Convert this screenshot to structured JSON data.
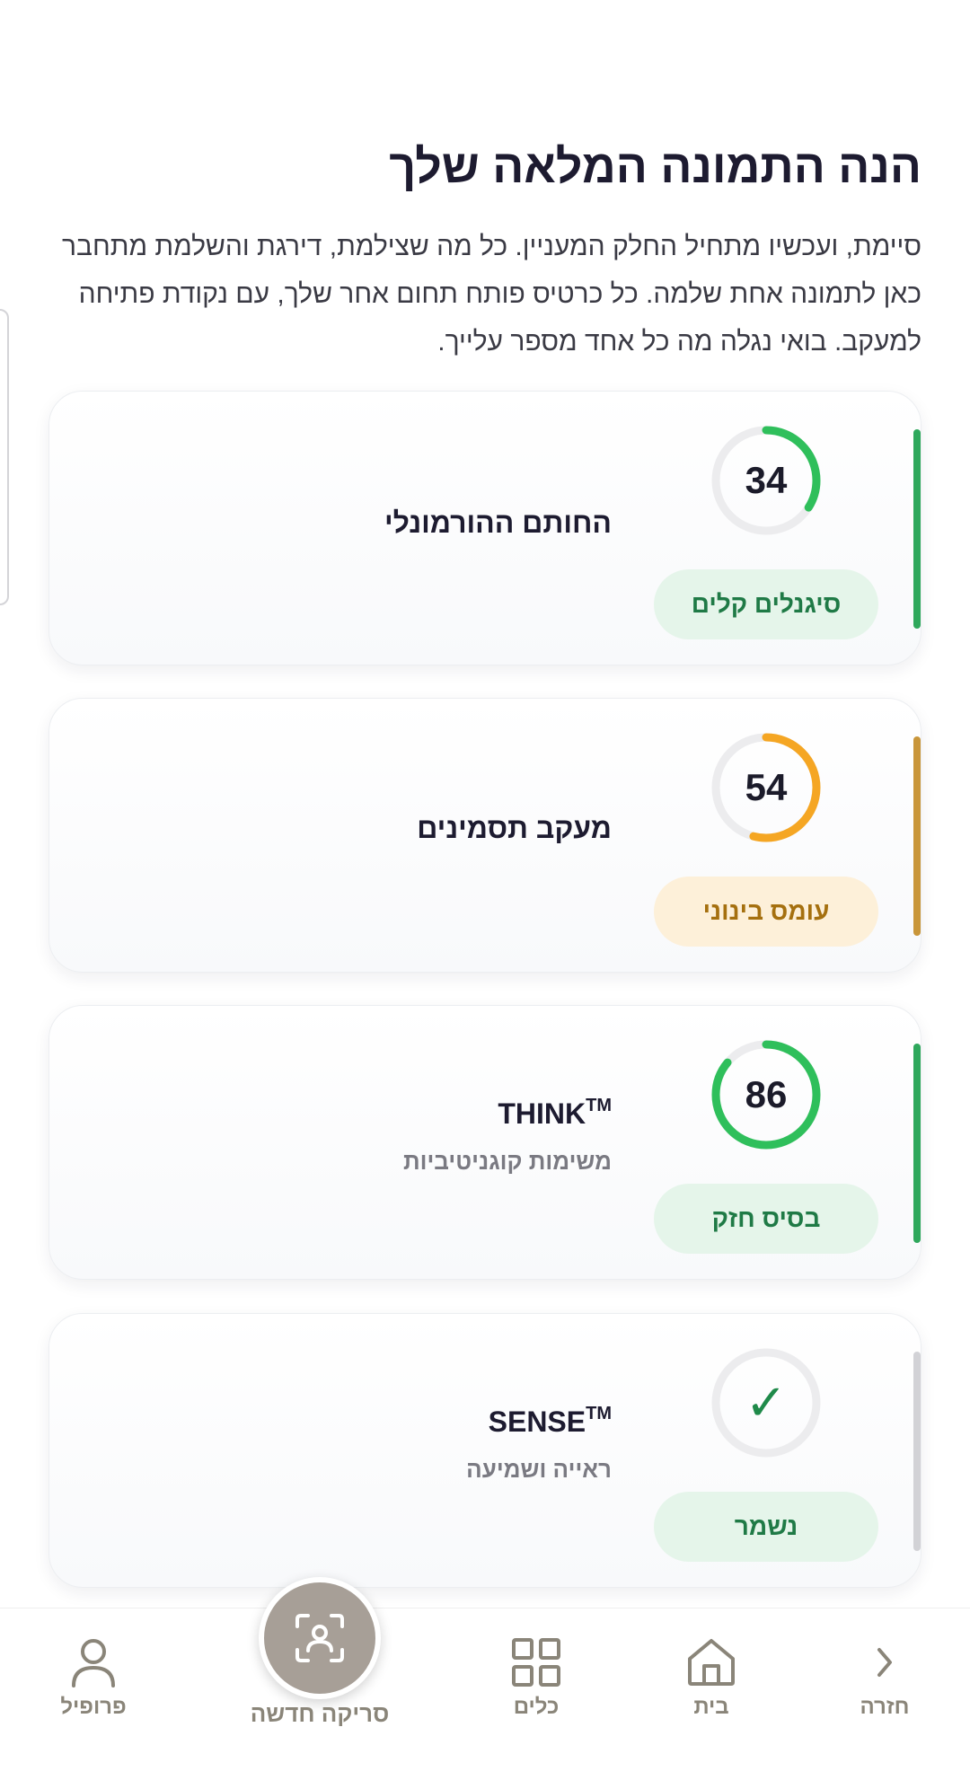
{
  "header": {
    "title": "הנה התמונה המלאה שלך",
    "intro": "סיימת, ועכשיו מתחיל החלק המעניין. כל מה שצילמת, דירגת והשלמת מתחבר כאן לתמונה אחת שלמה. כל כרטיס פותח תחום אחר שלך, עם נקודת פתיחה למעקב. בואי נגלה מה כל אחד מספר עלייך."
  },
  "cards": [
    {
      "title": "החותם ההורמונלי",
      "title_sup": "",
      "subtitle": "",
      "score": "34",
      "score_fraction": 0.34,
      "badge": "סיגנלים קלים",
      "status_color": "#2fbf5b",
      "accent_color": "#2fa85c"
    },
    {
      "title": "מעקב תסמינים",
      "title_sup": "",
      "subtitle": "",
      "score": "54",
      "score_fraction": 0.54,
      "badge": "עומס בינוני",
      "status_color": "#f5a623",
      "accent_color": "#c9963a"
    },
    {
      "title": "THINK",
      "title_sup": "TM",
      "subtitle": "משימות קוגניטיביות",
      "score": "86",
      "score_fraction": 0.86,
      "badge": "בסיס חזק",
      "status_color": "#2fbf5b",
      "accent_color": "#2fa85c"
    },
    {
      "title": "SENSE",
      "title_sup": "TM",
      "subtitle": "ראייה ושמיעה",
      "score": "✓",
      "score_fraction": 0,
      "badge": "נשמר",
      "status_color": "#1f8a4a",
      "accent_color": "#d2d2d6"
    }
  ],
  "nav": {
    "back": "חזרה",
    "home": "בית",
    "tools": "כלים",
    "scan": "סריקה חדשה",
    "profile": "פרופיל"
  },
  "icons": {
    "back": "chevron-right-icon",
    "home": "home-icon",
    "tools": "grid-icon",
    "scan": "face-scan-icon",
    "profile": "user-icon"
  }
}
